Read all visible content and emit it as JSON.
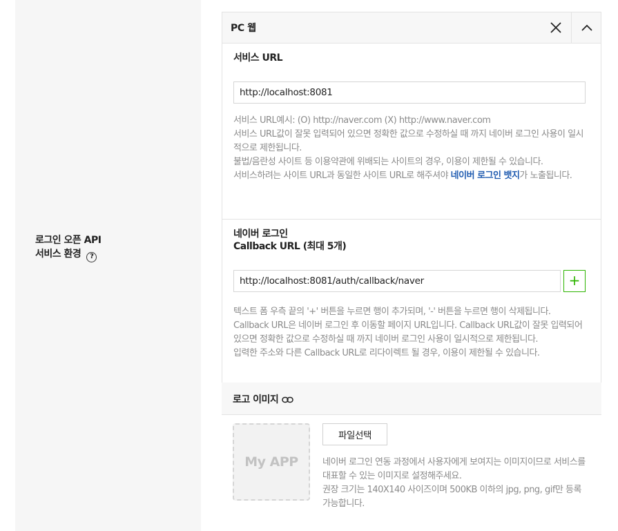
{
  "left": {
    "label_line1": "로그인 오픈 API",
    "label_line2": "서비스 환경",
    "help_icon": "?"
  },
  "platform": {
    "title": "PC 웹",
    "close_icon": "close-icon",
    "collapse_icon": "chevron-up-icon"
  },
  "service_url": {
    "title": "서비스 URL",
    "value": "http://localhost:8081",
    "help": [
      "서비스 URL예시: (O) http://naver.com (X) http://www.naver.com",
      "서비스 URL값이 잘못 입력되어 있으면 정확한 값으로 수정하실 때 까지 네이버 로그인 사용이 일시적으로 제한됩니다.",
      "불법/음란성 사이트 등 이용약관에 위배되는 사이트의 경우, 이용이 제한될 수 있습니다."
    ],
    "help_last_prefix": "서비스하려는 사이트 URL과 동일한 사이트 URL로 해주셔야 ",
    "help_last_highlight": "네이버 로그인 뱃지",
    "help_last_suffix": "가 노출됩니다."
  },
  "callback": {
    "title_line1": "네이버 로그인",
    "title_line2": "Callback URL (최대 5개)",
    "value": "http://localhost:8081/auth/callback/naver",
    "add_label": "+",
    "help": [
      "텍스트 폼 우측 끝의 '+' 버튼을 누르면 행이 추가되며, '-' 버튼을 누르면 행이 삭제됩니다.",
      "Callback URL은 네이버 로그인 후 이동할 페이지 URL입니다. Callback URL값이 잘못 입력되어 있으면 정확한 값으로 수정하실 때 까지 네이버 로그인 사용이 일시적으로 제한됩니다.",
      "입력한 주소와 다른 Callback URL로 리다이렉트 될 경우, 이용이 제한될 수 있습니다."
    ]
  },
  "logo": {
    "title": "로고 이미지",
    "link_icon": "link-icon",
    "placeholder": "My APP",
    "file_button": "파일선택",
    "help": [
      "네이버 로그인 연동 과정에서 사용자에게 보여지는 이미지이므로 서비스를 대표할 수 있는 이미지로 설정해주세요.",
      "권장 크기는 140X140 사이즈이며 500KB 이하의 jpg, png, gif만 등록 가능합니다."
    ]
  },
  "colors": {
    "accent_green": "#2db400",
    "link_blue": "#1f5bb0",
    "help_gray": "#8a8a8a"
  }
}
